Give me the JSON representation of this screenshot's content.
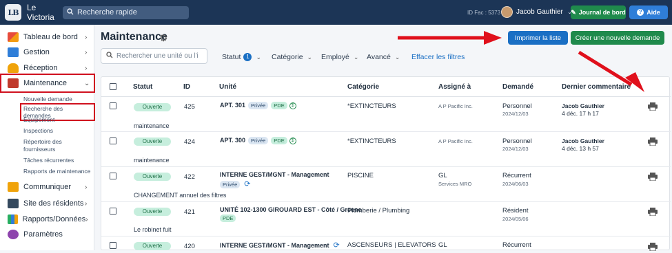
{
  "topbar": {
    "logo_text": "LB",
    "app_name": "Le Victoria",
    "search_placeholder": "Recherche rapide",
    "id_fac": "ID Fac : 5373",
    "user_name": "Jacob Gauthier",
    "journal_label": "Journal de bord",
    "aide_label": "Aide"
  },
  "sidebar": {
    "items": [
      {
        "label": "Tableau de bord",
        "icon": "dashboard-icon"
      },
      {
        "label": "Gestion",
        "icon": "building-icon"
      },
      {
        "label": "Réception",
        "icon": "reception-bell-icon"
      },
      {
        "label": "Maintenance",
        "icon": "toolbox-icon"
      },
      {
        "label": "Communiquer",
        "icon": "envelope-icon"
      },
      {
        "label": "Site des résidents",
        "icon": "computer-icon"
      },
      {
        "label": "Rapports/Données",
        "icon": "bar-chart-icon"
      },
      {
        "label": "Paramètres",
        "icon": "gear-icon"
      }
    ],
    "subitems": [
      "Nouvelle demande",
      "Recherche des demandes",
      "Équipement",
      "Inspections",
      "Répertoire des",
      "fournisseurs",
      "Tâches récurrentes",
      "Rapports de maintenance"
    ]
  },
  "main": {
    "title": "Maintenance",
    "print_list_label": "Imprimer la liste",
    "new_request_label": "Créer une nouvelle demande",
    "unit_search_placeholder": "Rechercher une unité ou l'i",
    "filters": {
      "statut": "Statut",
      "statut_count": "1",
      "categorie": "Catégorie",
      "employe": "Employé",
      "avance": "Avancé",
      "clear": "Effacer les filtres"
    },
    "columns": [
      "Statut",
      "ID",
      "Unité",
      "Catégorie",
      "Assigné à",
      "Demandé",
      "Dernier commentaire"
    ],
    "rows": [
      {
        "status": "Ouverte",
        "id": "425",
        "unit": "APT. 301",
        "tags": [
          "Privée",
          "PDE"
        ],
        "dollar": "$",
        "category": "*EXTINCTEURS",
        "assigned": "A P Pacific Inc.",
        "assigned_sub": "",
        "requested": "Personnel",
        "requested_date": "2024/12/03",
        "comment_author": "Jacob Gauthier",
        "comment_date": "4 déc. 17 h 17",
        "description": "maintenance"
      },
      {
        "status": "Ouverte",
        "id": "424",
        "unit": "APT. 300",
        "tags": [
          "Privée",
          "PDE"
        ],
        "dollar": "$",
        "category": "*EXTINCTEURS",
        "assigned": "A P Pacific Inc.",
        "assigned_sub": "",
        "requested": "Personnel",
        "requested_date": "2024/12/03",
        "comment_author": "Jacob Gauthier",
        "comment_date": "4 déc. 13 h 57",
        "description": "maintenance"
      },
      {
        "status": "Ouverte",
        "id": "422",
        "unit": "INTERNE GEST/MGNT - Management",
        "tags": [
          "Privée"
        ],
        "dollar": "",
        "category": "PISCINE",
        "assigned": "GL",
        "assigned_sub": "Services MRO",
        "requested": "Récurrent",
        "requested_date": "2024/06/03",
        "comment_author": "",
        "comment_date": "",
        "description": "CHANGEMENT annuel des filtres"
      },
      {
        "status": "Ouverte",
        "id": "421",
        "unit": "UNITÉ 102-1300 GIROUARD EST - Côté / Greene",
        "tags": [
          "PDE"
        ],
        "dollar": "",
        "category": "Plomberie / Plumbing",
        "assigned": "",
        "assigned_sub": "",
        "requested": "Résident",
        "requested_date": "2024/05/06",
        "comment_author": "",
        "comment_date": "",
        "description": "Le robinet fuit"
      },
      {
        "status": "Ouverte",
        "id": "420",
        "unit": "INTERNE GEST/MGNT - Management",
        "tags": [],
        "dollar": "",
        "category": "ASCENSEURS | ELEVATORS",
        "assigned": "GL",
        "assigned_sub": "",
        "requested": "Récurrent",
        "requested_date": "",
        "comment_author": "",
        "comment_date": "",
        "description": ""
      }
    ]
  },
  "colors": {
    "navy": "#1c3556",
    "green": "#1f8a4c",
    "blue": "#1a6fc4",
    "highlight_red": "#d0101e",
    "arrow_red": "#e0101c"
  }
}
